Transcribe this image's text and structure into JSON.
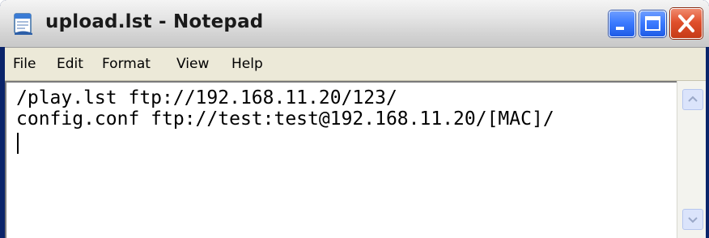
{
  "window": {
    "title": "upload.lst - Notepad"
  },
  "menu": {
    "items": [
      "File",
      "Edit",
      "Format",
      "View",
      "Help"
    ]
  },
  "editor": {
    "lines": [
      "/play.lst ftp://192.168.11.20/123/",
      "config.conf ftp://test:test@192.168.11.20/[MAC]/"
    ]
  },
  "icons": {
    "app": "notepad-icon",
    "minimize": "minimize-icon",
    "maximize": "maximize-icon",
    "close": "close-icon",
    "scroll_up": "scroll-up-arrow-icon",
    "scroll_down": "scroll-down-arrow-icon"
  },
  "colors": {
    "title_bar": "#d4d4d4",
    "control_blue": "#3c7bff",
    "control_close": "#e0502c",
    "menu_bg": "#ece9d8",
    "frame": "#0a246a"
  }
}
